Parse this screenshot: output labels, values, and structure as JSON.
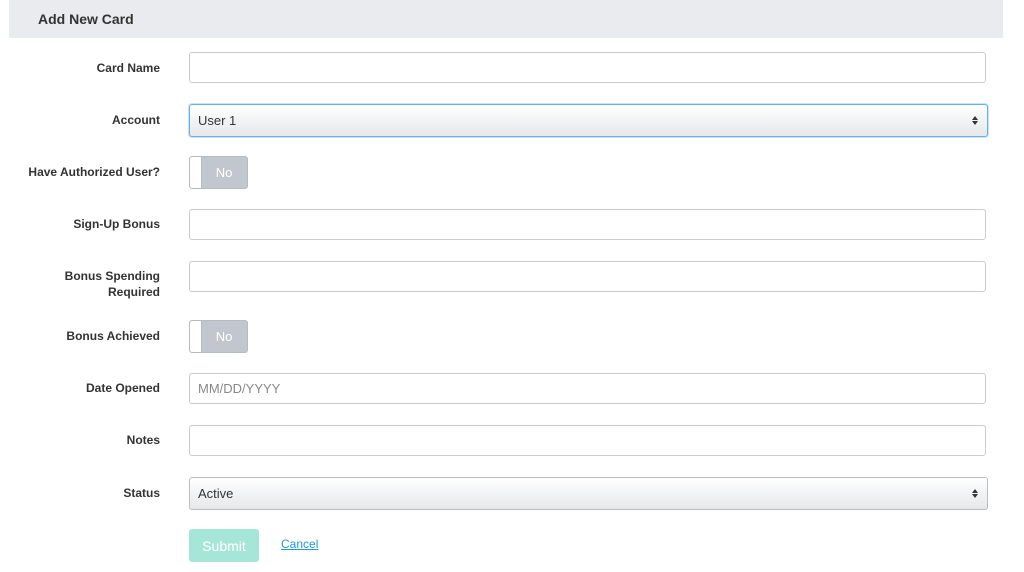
{
  "panel": {
    "title": "Add New Card"
  },
  "form": {
    "card_name": {
      "label": "Card Name",
      "value": ""
    },
    "account": {
      "label": "Account",
      "selected": "User 1"
    },
    "authorized_user": {
      "label": "Have Authorized User?",
      "state": "No"
    },
    "signup_bonus": {
      "label": "Sign-Up Bonus",
      "value": ""
    },
    "bonus_spending": {
      "label_line1": "Bonus Spending",
      "label_line2": "Required",
      "value": ""
    },
    "bonus_achieved": {
      "label": "Bonus Achieved",
      "state": "No"
    },
    "date_opened": {
      "label": "Date Opened",
      "placeholder": "MM/DD/YYYY"
    },
    "notes": {
      "label": "Notes",
      "value": ""
    },
    "status": {
      "label": "Status",
      "selected": "Active"
    }
  },
  "actions": {
    "submit_label": "Submit",
    "cancel_label": "Cancel"
  },
  "colors": {
    "submit_bg": "#a6e6d8",
    "link": "#1e9ad6",
    "header_bg": "#e9ebee",
    "toggle_bg": "#c2c7cf"
  }
}
